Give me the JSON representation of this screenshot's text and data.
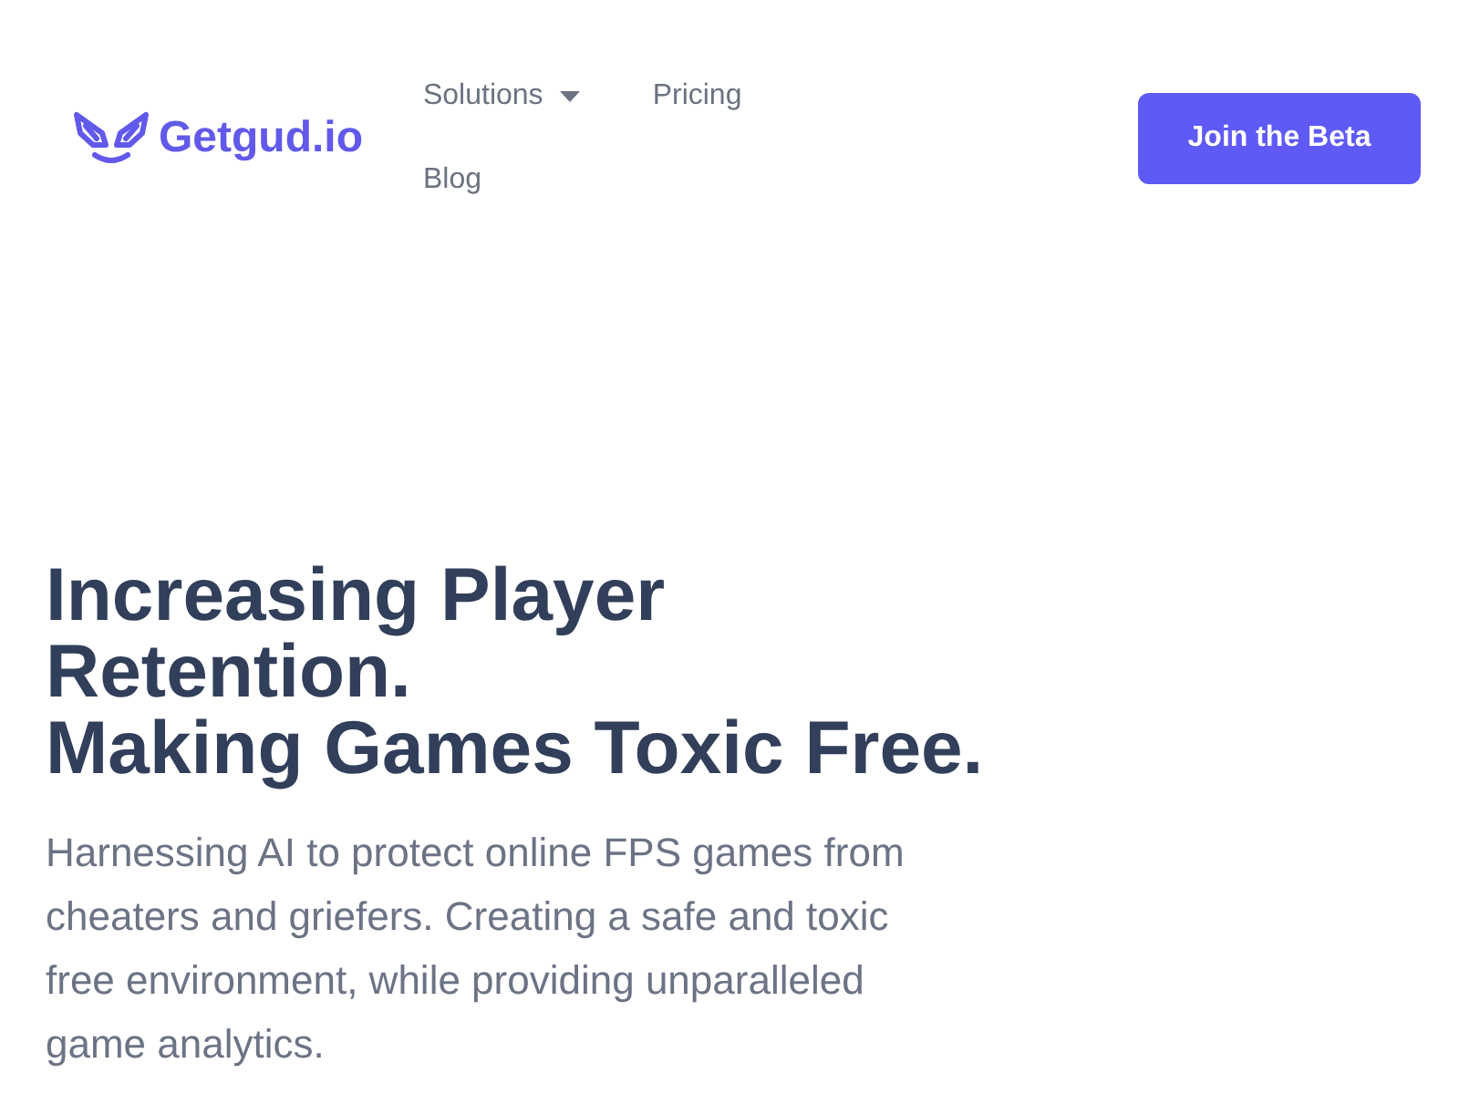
{
  "header": {
    "logo": {
      "text": "Getgud.io"
    },
    "nav": [
      {
        "label": "Solutions",
        "dropdown": true
      },
      {
        "label": "Pricing",
        "dropdown": false
      },
      {
        "label": "Blog",
        "dropdown": false
      }
    ],
    "cta": {
      "label": "Join the Beta"
    }
  },
  "hero": {
    "headline": [
      "Increasing Player Retention.",
      "Making Games Toxic Free."
    ],
    "subtitle": "Harnessing AI to protect online FPS games from cheaters and griefers. Creating a safe and toxic free environment, while providing unparalleled game analytics."
  }
}
